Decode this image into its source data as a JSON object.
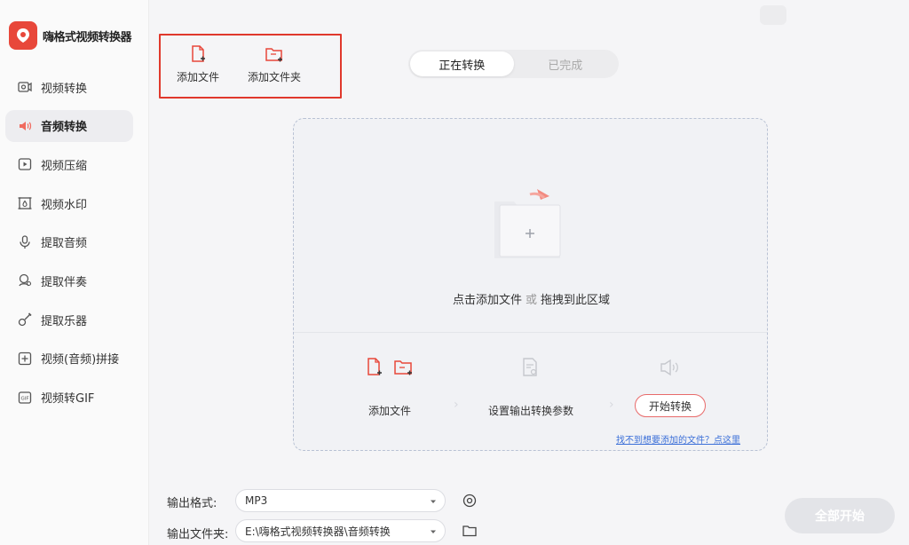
{
  "app": {
    "title": "嗨格式视频转换器"
  },
  "sidebar": {
    "items": [
      {
        "label": "视频转换",
        "icon": "video-convert-icon"
      },
      {
        "label": "音频转换",
        "icon": "audio-convert-icon",
        "active": true
      },
      {
        "label": "视频压缩",
        "icon": "video-compress-icon"
      },
      {
        "label": "视频水印",
        "icon": "video-watermark-icon"
      },
      {
        "label": "提取音频",
        "icon": "extract-audio-icon"
      },
      {
        "label": "提取伴奏",
        "icon": "extract-accompaniment-icon"
      },
      {
        "label": "提取乐器",
        "icon": "extract-instrument-icon"
      },
      {
        "label": "视频(音频)拼接",
        "icon": "splice-icon"
      },
      {
        "label": "视频转GIF",
        "icon": "gif-icon"
      }
    ]
  },
  "toolbar": {
    "add_file": "添加文件",
    "add_folder": "添加文件夹"
  },
  "tabs": {
    "converting": "正在转换",
    "done": "已完成"
  },
  "dropzone": {
    "hint_click": "点击添加文件",
    "hint_or": "或",
    "hint_drag": "拖拽到此区域",
    "step1": "添加文件",
    "step2": "设置输出转换参数",
    "step3": "开始转换",
    "help_link": "找不到想要添加的文件？点这里"
  },
  "output": {
    "format_label": "输出格式:",
    "format_value": "MP3",
    "folder_label": "输出文件夹:",
    "folder_value": "E:\\嗨格式视频转换器\\音频转换"
  },
  "actions": {
    "convert_all": "全部开始"
  },
  "colors": {
    "accent": "#e8473a",
    "link": "#3b6fd8",
    "highlight": "#e0382c"
  }
}
